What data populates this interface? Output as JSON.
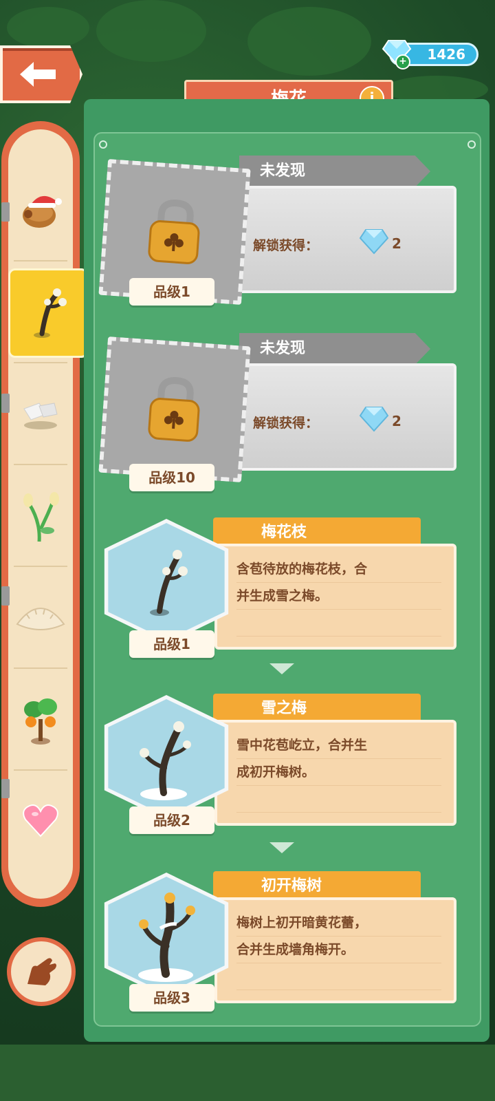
{
  "header": {
    "title": "梅花",
    "gem_count": "1426"
  },
  "sidebar": {
    "items": [
      {
        "icon": "potato-santa-hat-icon"
      },
      {
        "icon": "plum-branch-icon",
        "selected": true
      },
      {
        "icon": "sugar-cube-icon"
      },
      {
        "icon": "flower-sprout-icon"
      },
      {
        "icon": "dumpling-icon"
      },
      {
        "icon": "orange-tree-icon"
      },
      {
        "icon": "heart-icon"
      }
    ]
  },
  "locked": [
    {
      "status": "未发现",
      "unlock_label": "解锁获得：",
      "reward": "2",
      "grade": "品级1"
    },
    {
      "status": "未发现",
      "unlock_label": "解锁获得：",
      "reward": "2",
      "grade": "品级10"
    }
  ],
  "items": [
    {
      "name": "梅花枝",
      "desc_line1": "含苞待放的梅花枝，合",
      "desc_line2": "并生成雪之梅。",
      "grade": "品级1"
    },
    {
      "name": "雪之梅",
      "desc_line1": "雪中花苞屹立，合并生",
      "desc_line2": "成初开梅树。",
      "grade": "品级2"
    },
    {
      "name": "初开梅树",
      "desc_line1": "梅树上初开暗黄花蕾，",
      "desc_line2": "合并生成墙角梅开。",
      "grade": "品级3"
    }
  ],
  "colors": {
    "panel": "#3f9a63",
    "accent": "#e26a45",
    "tag": "#f4a934",
    "selected": "#f9cb2b"
  }
}
